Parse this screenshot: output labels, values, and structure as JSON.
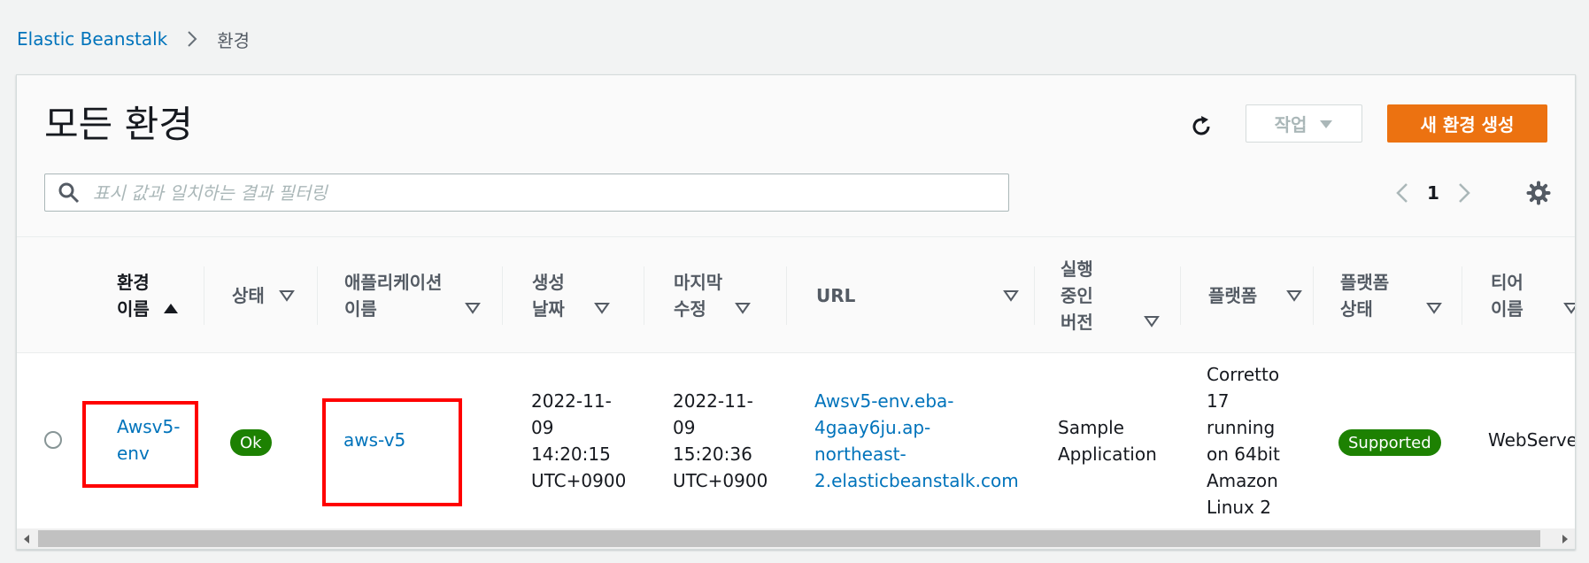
{
  "breadcrumb": {
    "root": "Elastic Beanstalk",
    "current": "환경"
  },
  "page": {
    "title": "모든 환경"
  },
  "toolbar": {
    "actions_label": "작업",
    "create_label": "새 환경 생성"
  },
  "search": {
    "placeholder": "표시 값과 일치하는 결과 필터링"
  },
  "pagination": {
    "current_page": "1"
  },
  "table": {
    "columns": [
      {
        "label": "환경\n이름",
        "sort": "asc"
      },
      {
        "label": "상태",
        "sort": "desc"
      },
      {
        "label": "애플리케이션\n이름",
        "sort": "desc"
      },
      {
        "label": "생성\n날짜",
        "sort": "desc"
      },
      {
        "label": "마지막\n수정",
        "sort": "desc"
      },
      {
        "label": "URL",
        "sort": "desc"
      },
      {
        "label": "실행\n중인\n버전",
        "sort": "desc"
      },
      {
        "label": "플랫폼",
        "sort": "desc"
      },
      {
        "label": "플랫폼\n상태",
        "sort": "desc"
      },
      {
        "label": "티어\n이름",
        "sort": "desc"
      }
    ],
    "rows": [
      {
        "env_name": "Awsv5-\nenv",
        "status": "Ok",
        "app_name": "aws-v5",
        "created": "2022-11-\n09\n14:20:15\nUTC+0900",
        "modified": "2022-11-\n09\n15:20:36\nUTC+0900",
        "url": "Awsv5-env.eba-\n4gaay6ju.ap-\nnortheast-\n2.elasticbeanstalk.com",
        "version": "Sample\nApplication",
        "platform": "Corretto\n17\nrunning\non 64bit\nAmazon\nLinux 2",
        "platform_state": "Supported",
        "tier": "WebServer"
      }
    ]
  },
  "colors": {
    "link": "#0073bb",
    "primary": "#ec7211",
    "success": "#1d8102",
    "highlight": "#ff0000"
  },
  "icons": [
    "chevron-right-icon",
    "refresh-icon",
    "caret-down-icon",
    "search-icon",
    "chevron-left-icon",
    "gear-icon",
    "sort-asc-icon",
    "sort-desc-icon"
  ]
}
